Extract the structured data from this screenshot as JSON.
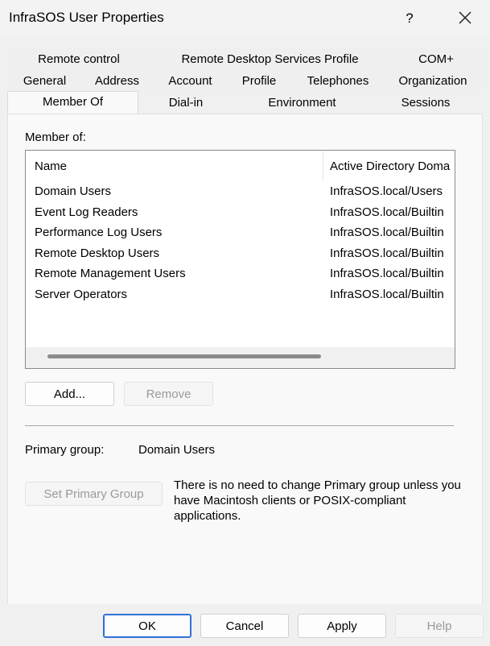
{
  "window": {
    "title": "InfraSOS User Properties",
    "help_glyph": "?",
    "close_glyph": "✕"
  },
  "tabs": {
    "row1": [
      "Remote control",
      "Remote Desktop Services Profile",
      "COM+"
    ],
    "row2": [
      "General",
      "Address",
      "Account",
      "Profile",
      "Telephones",
      "Organization"
    ],
    "row3": [
      "Member Of",
      "Dial-in",
      "Environment",
      "Sessions"
    ],
    "active": "Member Of"
  },
  "member_of": {
    "label": "Member of:",
    "columns": [
      "Name",
      "Active Directory Doma"
    ],
    "rows": [
      {
        "name": "Domain Users",
        "folder": "InfraSOS.local/Users"
      },
      {
        "name": "Event Log Readers",
        "folder": "InfraSOS.local/Builtin"
      },
      {
        "name": "Performance Log Users",
        "folder": "InfraSOS.local/Builtin"
      },
      {
        "name": "Remote Desktop Users",
        "folder": "InfraSOS.local/Builtin"
      },
      {
        "name": "Remote Management Users",
        "folder": "InfraSOS.local/Builtin"
      },
      {
        "name": "Server Operators",
        "folder": "InfraSOS.local/Builtin"
      }
    ]
  },
  "actions": {
    "add": "Add...",
    "remove": "Remove"
  },
  "primary_group": {
    "label": "Primary group:",
    "value": "Domain Users",
    "set_button": "Set Primary Group",
    "note": "There is no need to change Primary group unless you have Macintosh clients or POSIX-compliant applications."
  },
  "footer": {
    "ok": "OK",
    "cancel": "Cancel",
    "apply": "Apply",
    "help": "Help"
  },
  "colors": {
    "accent": "#2f6fd6",
    "disabled_text": "#9a9a9a"
  },
  "icons": {
    "help": "question-mark-icon",
    "close": "close-icon"
  }
}
